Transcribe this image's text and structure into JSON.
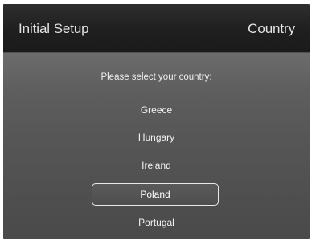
{
  "header": {
    "title": "Initial Setup",
    "section": "Country"
  },
  "prompt": "Please select your country:",
  "countries": {
    "items": [
      "Greece",
      "Hungary",
      "Ireland",
      "Poland",
      "Portugal"
    ],
    "selected": "Poland"
  },
  "colors": {
    "header_bg": "#1f1f1f",
    "header_text": "#e3e3e3",
    "panel_bg_top": "#6c6c6c",
    "panel_bg_bottom": "#4a4a4a",
    "text": "#f2f2f2",
    "selection_border": "#e8e8e8"
  }
}
